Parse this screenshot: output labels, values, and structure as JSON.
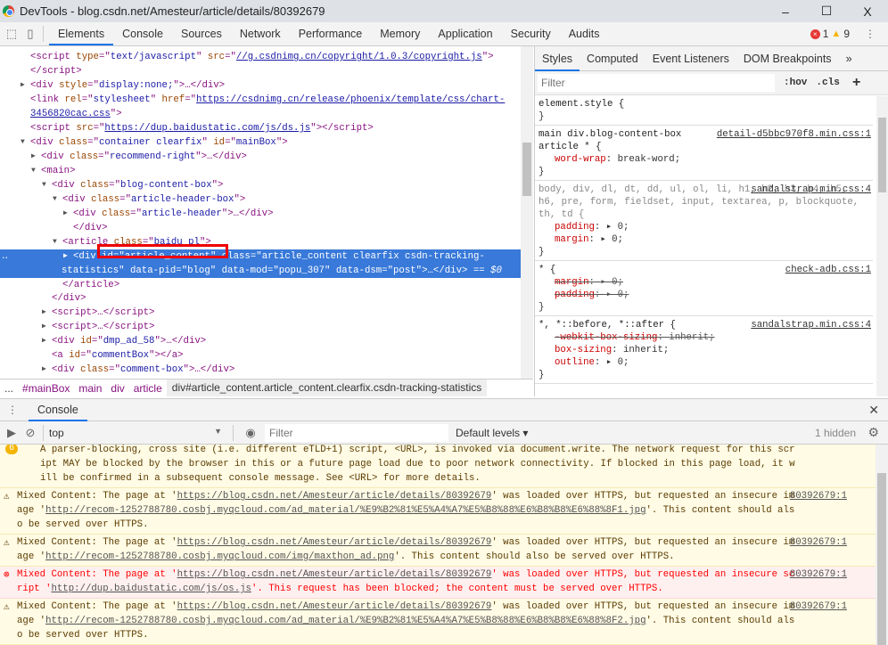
{
  "window": {
    "title": "DevTools - blog.csdn.net/Amesteur/article/details/80392679",
    "minimize": "–",
    "maximize": "☐",
    "close": "X"
  },
  "toolbar": {
    "tabs": [
      "Elements",
      "Console",
      "Sources",
      "Network",
      "Performance",
      "Memory",
      "Application",
      "Security",
      "Audits"
    ],
    "active": "Elements",
    "error_count": "1",
    "warning_count": "9",
    "more": "⋮"
  },
  "elements": {
    "lines": [
      {
        "d": 0,
        "a": "",
        "t": [
          [
            "tag",
            "<script "
          ],
          [
            "attr",
            "type"
          ],
          [
            "tag",
            "=\""
          ],
          [
            "val",
            "text/javascript"
          ],
          [
            "tag",
            "\" "
          ],
          [
            "attr",
            "src"
          ],
          [
            "tag",
            "=\""
          ],
          [
            "link",
            "//g.csdnimg.cn/copyright/1.0.3/copyright.js"
          ],
          [
            "tag",
            "\">"
          ]
        ]
      },
      {
        "d": 0,
        "a": "",
        "t": [
          [
            "tag",
            "</script>"
          ]
        ]
      },
      {
        "d": 0,
        "a": "▶",
        "t": [
          [
            "tag",
            "<div "
          ],
          [
            "attr",
            "style"
          ],
          [
            "tag",
            "=\""
          ],
          [
            "val",
            "display:none;"
          ],
          [
            "tag",
            "\">…</div>"
          ]
        ]
      },
      {
        "d": 0,
        "a": "",
        "t": [
          [
            "tag",
            "<link "
          ],
          [
            "attr",
            "rel"
          ],
          [
            "tag",
            "=\""
          ],
          [
            "val",
            "stylesheet"
          ],
          [
            "tag",
            "\" "
          ],
          [
            "attr",
            "href"
          ],
          [
            "tag",
            "=\""
          ],
          [
            "link",
            "https://csdnimg.cn/release/phoenix/template/css/chart-"
          ]
        ]
      },
      {
        "d": 0,
        "a": "",
        "t": [
          [
            "link",
            "3456820cac.css"
          ],
          [
            "tag",
            "\">"
          ]
        ]
      },
      {
        "d": 0,
        "a": "",
        "t": [
          [
            "tag",
            "<script "
          ],
          [
            "attr",
            "src"
          ],
          [
            "tag",
            "=\""
          ],
          [
            "link",
            "https://dup.baidustatic.com/js/ds.js"
          ],
          [
            "tag",
            "\"></script>"
          ]
        ]
      },
      {
        "d": 0,
        "a": "▼",
        "t": [
          [
            "tag",
            "<div "
          ],
          [
            "attr",
            "class"
          ],
          [
            "tag",
            "=\""
          ],
          [
            "val",
            "container clearfix"
          ],
          [
            "tag",
            "\" "
          ],
          [
            "attr",
            "id"
          ],
          [
            "tag",
            "=\""
          ],
          [
            "val",
            "mainBox"
          ],
          [
            "tag",
            "\">"
          ]
        ]
      },
      {
        "d": 1,
        "a": "▶",
        "t": [
          [
            "tag",
            "<div "
          ],
          [
            "attr",
            "class"
          ],
          [
            "tag",
            "=\""
          ],
          [
            "val",
            "recommend-right"
          ],
          [
            "tag",
            "\">…</div>"
          ]
        ]
      },
      {
        "d": 1,
        "a": "▼",
        "t": [
          [
            "tag",
            "<main>"
          ]
        ]
      },
      {
        "d": 2,
        "a": "▼",
        "t": [
          [
            "tag",
            "<div "
          ],
          [
            "attr",
            "class"
          ],
          [
            "tag",
            "=\""
          ],
          [
            "val",
            "blog-content-box"
          ],
          [
            "tag",
            "\">"
          ]
        ]
      },
      {
        "d": 3,
        "a": "▼",
        "t": [
          [
            "tag",
            "<div "
          ],
          [
            "attr",
            "class"
          ],
          [
            "tag",
            "=\""
          ],
          [
            "val",
            "article-header-box"
          ],
          [
            "tag",
            "\">"
          ]
        ]
      },
      {
        "d": 4,
        "a": "▶",
        "t": [
          [
            "tag",
            "<div "
          ],
          [
            "attr",
            "class"
          ],
          [
            "tag",
            "=\""
          ],
          [
            "val",
            "article-header"
          ],
          [
            "tag",
            "\">…</div>"
          ]
        ]
      },
      {
        "d": 4,
        "a": "",
        "t": [
          [
            "tag",
            "</div>"
          ]
        ]
      },
      {
        "d": 3,
        "a": "▼",
        "t": [
          [
            "tag",
            "<article "
          ],
          [
            "attr",
            "class"
          ],
          [
            "tag",
            "=\""
          ],
          [
            "val",
            "baidu_pl"
          ],
          [
            "tag",
            "\">"
          ]
        ]
      },
      {
        "d": 4,
        "a": "▶",
        "sel": true,
        "t": [
          [
            "tag",
            "<div "
          ],
          [
            "attr",
            "id"
          ],
          [
            "tag",
            "=\""
          ],
          [
            "val",
            "article_content"
          ],
          [
            "tag",
            "\" "
          ],
          [
            "attr",
            "class"
          ],
          [
            "tag",
            "=\""
          ],
          [
            "val",
            "article_content clearfix csdn-tracking-"
          ]
        ]
      },
      {
        "d": 3,
        "a": "",
        "sel": true,
        "t": [
          [
            "val",
            "statistics"
          ],
          [
            "tag",
            "\" "
          ],
          [
            "attr",
            "data-pid"
          ],
          [
            "tag",
            "=\""
          ],
          [
            "val",
            "blog"
          ],
          [
            "tag",
            "\" "
          ],
          [
            "attr",
            "data-mod"
          ],
          [
            "tag",
            "=\""
          ],
          [
            "val",
            "popu_307"
          ],
          [
            "tag",
            "\" "
          ],
          [
            "attr",
            "data-dsm"
          ],
          [
            "tag",
            "=\""
          ],
          [
            "val",
            "post"
          ],
          [
            "tag",
            "\">…</div>"
          ],
          [
            "eq",
            " == $0"
          ]
        ]
      },
      {
        "d": 3,
        "a": "",
        "t": [
          [
            "tag",
            "</article>"
          ]
        ]
      },
      {
        "d": 2,
        "a": "",
        "t": [
          [
            "tag",
            "</div>"
          ]
        ]
      },
      {
        "d": 2,
        "a": "▶",
        "t": [
          [
            "tag",
            "<script>…</script>"
          ]
        ]
      },
      {
        "d": 2,
        "a": "▶",
        "t": [
          [
            "tag",
            "<script>…</script>"
          ]
        ]
      },
      {
        "d": 2,
        "a": "▶",
        "t": [
          [
            "tag",
            "<div "
          ],
          [
            "attr",
            "id"
          ],
          [
            "tag",
            "=\""
          ],
          [
            "val",
            "dmp_ad_58"
          ],
          [
            "tag",
            "\">…</div>"
          ]
        ]
      },
      {
        "d": 2,
        "a": "",
        "t": [
          [
            "tag",
            "<a "
          ],
          [
            "attr",
            "id"
          ],
          [
            "tag",
            "=\""
          ],
          [
            "val",
            "commentBox"
          ],
          [
            "tag",
            "\"></a>"
          ]
        ]
      },
      {
        "d": 2,
        "a": "▶",
        "t": [
          [
            "tag",
            "<div "
          ],
          [
            "attr",
            "class"
          ],
          [
            "tag",
            "=\""
          ],
          [
            "val",
            "comment-box"
          ],
          [
            "tag",
            "\">…</div>"
          ]
        ]
      }
    ],
    "breadcrumbs": [
      "...",
      "#mainBox",
      "main",
      "div",
      "article",
      "div#article_content.article_content.clearfix.csdn-tracking-statistics"
    ]
  },
  "styles": {
    "tabs": [
      "Styles",
      "Computed",
      "Event Listeners",
      "DOM Breakpoints",
      "»"
    ],
    "filter_placeholder": "Filter",
    "hov": ":hov",
    "cls": ".cls",
    "add": "+",
    "rules": [
      {
        "sel": "element.style {",
        "src": "",
        "props": []
      },
      {
        "sel": "main div.blog-content-box article * {",
        "src": "detail-d5bbc970f8.min.css:1",
        "props": [
          {
            "n": "word-wrap",
            "v": "break-word;"
          }
        ]
      },
      {
        "sel": "body, div, dl, dt, dd, ul, ol, li, h1, h2, h3, h4, h5, h6, pre, form, fieldset, input, textarea, p, blockquote, th, td {",
        "src": "sandalstrap.min.css:4",
        "props": [
          {
            "n": "padding",
            "v": "▸ 0;"
          },
          {
            "n": "margin",
            "v": "▸ 0;"
          }
        ]
      },
      {
        "sel": "* {",
        "src": "check-adb.css:1",
        "props": [
          {
            "n": "margin",
            "v": "▸ 0;",
            "s": true
          },
          {
            "n": "padding",
            "v": "▸ 0;",
            "s": true
          }
        ]
      },
      {
        "sel": "*, *::before, *::after {",
        "src": "sandalstrap.min.css:4",
        "props": [
          {
            "n": "-webkit-box-sizing",
            "v": "inherit;",
            "s": true
          },
          {
            "n": "box-sizing",
            "v": "inherit;"
          },
          {
            "n": "outline",
            "v": "▸ 0;"
          }
        ]
      }
    ]
  },
  "console": {
    "drawer_tab": "Console",
    "context": "top",
    "filter_placeholder": "Filter",
    "levels": "Default levels ▾",
    "hidden": "1 hidden",
    "messages": [
      {
        "level": "warning",
        "count": "6",
        "parts": [
          [
            "t",
            "A parser-blocking, cross site (i.e. different eTLD+1) script, <URL>, is invoked via document.write. The network request for this script MAY be blocked by the browser in this or a future page load due to poor network connectivity. If blocked in this page load, it will be confirmed in a subsequent console message. See <URL> for more details."
          ]
        ],
        "src": ""
      },
      {
        "level": "warning",
        "parts": [
          [
            "t",
            "Mixed Content: The page at '"
          ],
          [
            "a",
            "https://blog.csdn.net/Amesteur/article/details/80392679"
          ],
          [
            "t",
            "' was loaded over HTTPS, but requested an insecure image '"
          ],
          [
            "a",
            "http://recom-1252788780.cosbj.myqcloud.com/ad_material/%E9%B2%81%E5%A4%A7%E5%B8%88%E6%B8%B8%E6%88%8F1.jpg"
          ],
          [
            "t",
            "'. This content should also be served over HTTPS."
          ]
        ],
        "src": "80392679:1"
      },
      {
        "level": "warning",
        "parts": [
          [
            "t",
            "Mixed Content: The page at '"
          ],
          [
            "a",
            "https://blog.csdn.net/Amesteur/article/details/80392679"
          ],
          [
            "t",
            "' was loaded over HTTPS, but requested an insecure image '"
          ],
          [
            "a",
            "http://recom-1252788780.cosbj.myqcloud.com/img/maxthon_ad.png"
          ],
          [
            "t",
            "'. This content should also be served over HTTPS."
          ]
        ],
        "src": "80392679:1"
      },
      {
        "level": "error",
        "parts": [
          [
            "t",
            "Mixed Content: The page at '"
          ],
          [
            "a",
            "https://blog.csdn.net/Amesteur/article/details/80392679"
          ],
          [
            "t",
            "' was loaded over HTTPS, but requested an insecure script '"
          ],
          [
            "a",
            "http://dup.baidustatic.com/js/os.js"
          ],
          [
            "t",
            "'. This request has been blocked; the content must be served over HTTPS."
          ]
        ],
        "src": "80392679:1"
      },
      {
        "level": "warning",
        "parts": [
          [
            "t",
            "Mixed Content: The page at '"
          ],
          [
            "a",
            "https://blog.csdn.net/Amesteur/article/details/80392679"
          ],
          [
            "t",
            "' was loaded over HTTPS, but requested an insecure image '"
          ],
          [
            "a",
            "http://recom-1252788780.cosbj.myqcloud.com/ad_material/%E9%B2%81%E5%A4%A7%E5%B8%88%E6%B8%B8%E6%88%8F2.jpg"
          ],
          [
            "t",
            "'. This content should also be served over HTTPS."
          ]
        ],
        "src": "80392679:1"
      }
    ],
    "prompt": "›"
  },
  "colors": {
    "accent": "#1a73e8",
    "selection": "#3879d9",
    "highlight_box": "#ee0000",
    "warning_bg": "#fffbe5",
    "error_bg": "#fff0f0"
  }
}
